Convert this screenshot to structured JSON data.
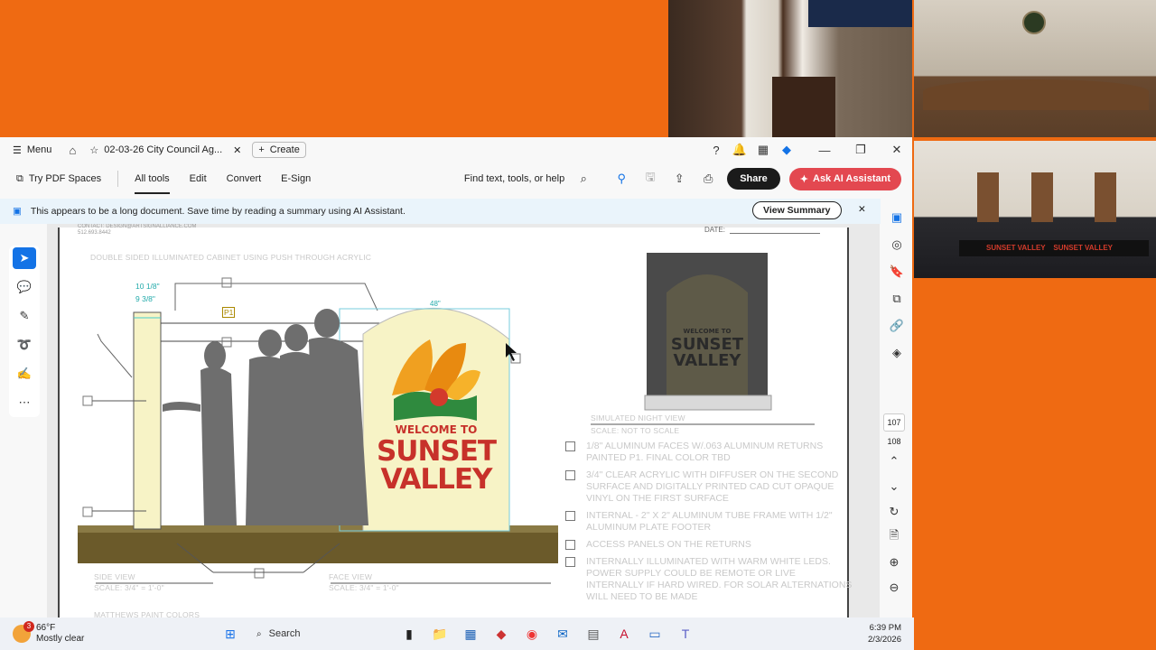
{
  "tab": {
    "title": "02-03-26 City Council Ag...",
    "create_label": "Create",
    "menu_label": "Menu"
  },
  "toolbar": {
    "spaces_label": "Try PDF Spaces",
    "tabs": [
      "All tools",
      "Edit",
      "Convert",
      "E-Sign"
    ],
    "find_placeholder": "Find text, tools, or help",
    "share_label": "Share",
    "ai_label": "Ask AI Assistant"
  },
  "notice": {
    "text": "This appears to be a long document. Save time by reading a summary using AI Assistant.",
    "button": "View Summary"
  },
  "pages": {
    "current": "107",
    "next": "108"
  },
  "document": {
    "contact": "CONTACT: DESIGN@ARTSIGNALLIANCE.COM",
    "phone": "512.693.8442",
    "date_label": "DATE:",
    "header_note": "DOUBLE SIDED ILLUMINATED CABINET USING PUSH THROUGH ACRYLIC",
    "dim_1": "10 1/8\"",
    "dim_2": "9 3/8\"",
    "dim_3": "48\"",
    "marker": "P1",
    "sign_line1": "WELCOME TO",
    "sign_line2": "SUNSET",
    "sign_line3": "VALLEY",
    "side_view": "SIDE VIEW",
    "side_scale": "SCALE: 3/4\" = 1'-0\"",
    "face_view": "FACE VIEW",
    "face_scale": "SCALE: 3/4\" = 1'-0\"",
    "night_label": "SIMULATED NIGHT VIEW",
    "night_scale": "SCALE: NOT TO SCALE",
    "bottom_cut": "MATTHEWS PAINT COLORS",
    "notes": [
      "1/8\" ALUMINUM FACES W/.063 ALUMINUM RETURNS PAINTED P1. FINAL COLOR TBD",
      "3/4\" CLEAR ACRYLIC WITH DIFFUSER ON THE SECOND SURFACE AND DIGITALLY PRINTED CAD CUT OPAQUE VINYL ON THE FIRST SURFACE",
      "INTERNAL - 2\" X 2\" ALUMINUM TUBE FRAME WITH 1/2\" ALUMINUM PLATE FOOTER",
      "ACCESS PANELS ON THE RETURNS",
      "INTERNALLY ILLUMINATED WITH WARM WHITE LEDS.  POWER SUPPLY COULD BE REMOTE OR LIVE INTERNALLY IF HARD WIRED. FOR SOLAR ALTERNATIONS WILL NEED TO BE MADE"
    ]
  },
  "taskbar": {
    "weather_temp": "66°F",
    "weather_desc": "Mostly clear",
    "weather_badge": "3",
    "search_placeholder": "Search",
    "time": "6:39 PM",
    "date": "2/3/2026"
  },
  "colors": {
    "accent": "#1473e6",
    "ai": "#e34850",
    "background": "#ef6a12",
    "sign_red": "#c7312a",
    "sign_cream": "#f7f3c6",
    "ground": "#6b5a2a"
  }
}
